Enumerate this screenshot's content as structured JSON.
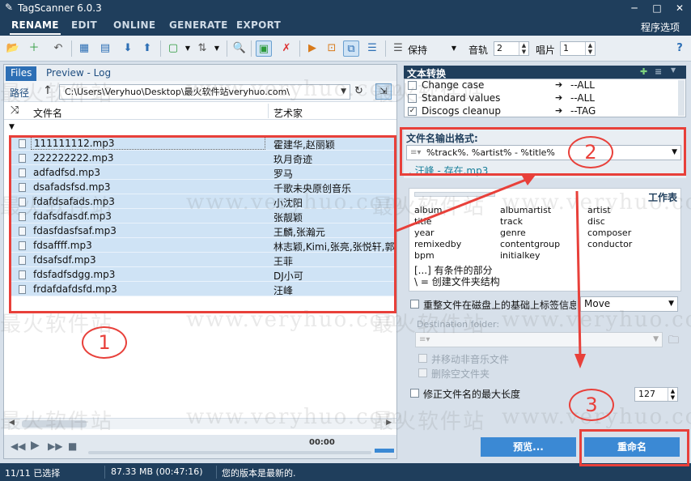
{
  "window": {
    "title": "TagScanner 6.0.3"
  },
  "menu": {
    "tabs": [
      "RENAME",
      "EDIT",
      "ONLINE",
      "GENERATE",
      "EXPORT"
    ],
    "program_options": "程序选项"
  },
  "toolbar": {
    "keep_label": "保持",
    "track_label": "音轨",
    "track_value": "2",
    "disc_label": "唱片",
    "disc_value": "1"
  },
  "left_panel": {
    "tabs": [
      "Files",
      "Preview - Log"
    ],
    "path_label": "路径",
    "path": "C:\\Users\\Veryhuo\\Desktop\\最火软件站veryhuo.com\\",
    "col_filename": "文件名",
    "col_artist": "艺术家",
    "files": [
      {
        "name": "111111112.mp3",
        "artist": "霍建华,赵丽颖"
      },
      {
        "name": "222222222.mp3",
        "artist": "玖月奇迹"
      },
      {
        "name": "adfadfsd.mp3",
        "artist": "罗马"
      },
      {
        "name": "dsafadsfsd.mp3",
        "artist": "千歌未央原创音乐"
      },
      {
        "name": "fdafdsafads.mp3",
        "artist": "小沈阳"
      },
      {
        "name": "fdafsdfasdf.mp3",
        "artist": "张靓颖"
      },
      {
        "name": "fdasfdasfsaf.mp3",
        "artist": "王麟,张瀚元"
      },
      {
        "name": "fdsaffff.mp3",
        "artist": "林志颖,Kimi,张亮,张悦轩,郭..."
      },
      {
        "name": "fdsafsdf.mp3",
        "artist": "王菲"
      },
      {
        "name": "fdsfadfsdgg.mp3",
        "artist": "DJ小可"
      },
      {
        "name": "frdafdafdsfd.mp3",
        "artist": "汪峰"
      }
    ]
  },
  "player": {
    "time": "00:00"
  },
  "status": {
    "selected": "11/11 已选择",
    "size": "87.33 MB (00:47:16)",
    "message": "您的版本是最新的."
  },
  "right_panel": {
    "title": "文本转换",
    "conversions": [
      {
        "name": "Change case",
        "checked": false,
        "value": "--ALL"
      },
      {
        "name": "Standard values",
        "checked": false,
        "value": "--ALL"
      },
      {
        "name": "Discogs cleanup",
        "checked": true,
        "value": "--TAG"
      }
    ],
    "format_label": "文件名输出格式:",
    "format_value": "%track%. %artist% - %title%",
    "preview_name": ". 汪峰 - 存在.mp3",
    "workspace_title": "工作表",
    "tokens": [
      "album",
      "albumartist",
      "artist",
      "title",
      "track",
      "disc",
      "year",
      "genre",
      "composer",
      "remixedby",
      "contentgroup",
      "conductor",
      "bpm",
      "initialkey"
    ],
    "note1": "[...] 有条件的部分",
    "note2": "\\ = 创建文件夹结构",
    "reorganize_label": "重整文件在磁盘上的基础上标签信息",
    "move_option": "Move",
    "dest_label": "Destination folder:",
    "move_non_music": "并移动非音乐文件",
    "delete_empty": "删除空文件夹",
    "max_length_label": "修正文件名的最大长度",
    "max_length_value": "127",
    "preview_button": "预览...",
    "rename_button": "重命名"
  },
  "annotations": {
    "n1": "1",
    "n2": "2",
    "n3": "3"
  },
  "watermark": {
    "cn": "最火软件站",
    "en": "www.veryhuo.com"
  },
  "colors": {
    "accent": "#3b89d4",
    "dark": "#1f3e5c",
    "annot": "#e8403a",
    "selection": "#cfe3f5"
  }
}
